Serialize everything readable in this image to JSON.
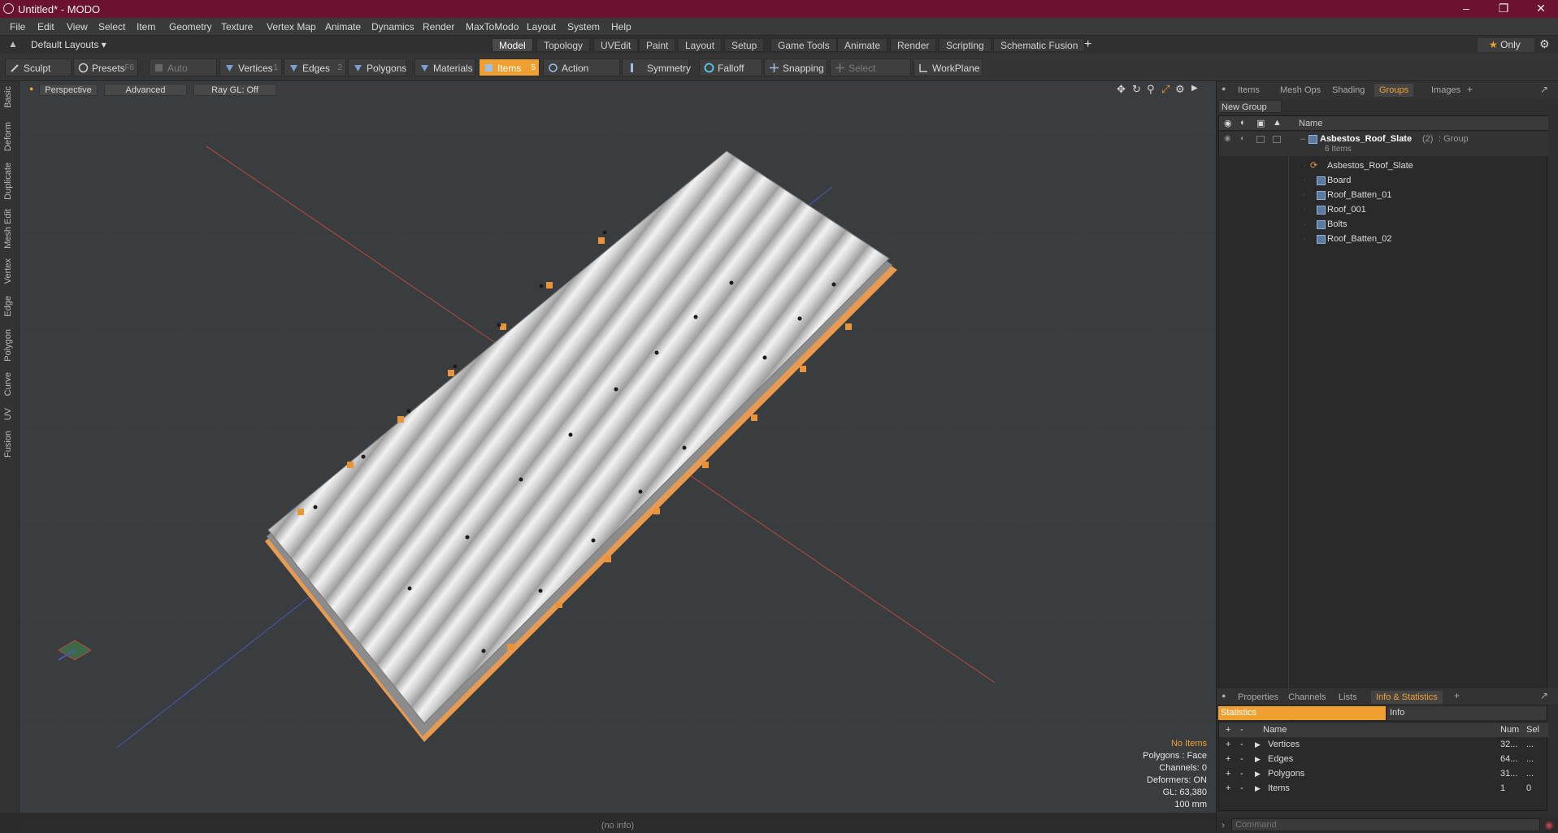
{
  "window": {
    "title": "Untitled* - MODO"
  },
  "menubar": [
    "File",
    "Edit",
    "View",
    "Select",
    "Item",
    "Geometry",
    "Texture",
    "Vertex Map",
    "Animate",
    "Dynamics",
    "Render",
    "MaxToModo",
    "Layout",
    "System",
    "Help"
  ],
  "layouts": {
    "current": "Default Layouts",
    "only_label": "Only"
  },
  "layout_tabs": [
    "Model",
    "Topology",
    "UVEdit",
    "Paint",
    "Layout",
    "Setup",
    "Game Tools",
    "Animate",
    "Render",
    "Scripting",
    "Schematic Fusion"
  ],
  "toolbar": {
    "sculpt": "Sculpt",
    "presets": "Presets",
    "presets_key": "F6",
    "auto_select": "Auto Select",
    "vertices": "Vertices",
    "vertices_key": "1",
    "edges": "Edges",
    "edges_key": "2",
    "polygons": "Polygons",
    "materials": "Materials",
    "items": "Items",
    "items_key": "5",
    "action_center": "Action Center",
    "symmetry": "Symmetry",
    "falloff": "Falloff",
    "snapping": "Snapping",
    "select_through": "Select Through",
    "workplane": "WorkPlane"
  },
  "left_tabs": [
    "Basic",
    "Deform",
    "Duplicate",
    "Mesh Edit",
    "Vertex",
    "Edge",
    "Polygon",
    "Curve",
    "UV",
    "Fusion"
  ],
  "viewport": {
    "view": "Perspective",
    "shading": "Advanced",
    "raygl": "Ray GL: Off",
    "stats": {
      "items": "No Items",
      "polygons": "Polygons : Face",
      "channels": "Channels: 0",
      "deformers": "Deformers: ON",
      "gl": "GL: 63,380",
      "scale": "100 mm"
    }
  },
  "status": "(no info)",
  "groups_panel": {
    "tabs": [
      "Items",
      "Mesh Ops",
      "Shading",
      "Groups",
      "Images"
    ],
    "new_group": "New Group",
    "column_name": "Name",
    "group_name": "Asbestos_Roof_Slate",
    "group_count": "(2)",
    "group_type": ": Group",
    "group_items": "6 Items",
    "children": [
      "Asbestos_Roof_Slate",
      "Board",
      "Roof_Batten_01",
      "Roof_001",
      "Bolts",
      "Roof_Batten_02"
    ]
  },
  "info_panel": {
    "tabs": [
      "Properties",
      "Channels",
      "Lists",
      "Info & Statistics"
    ],
    "sub_tabs": [
      "Statistics",
      "Info"
    ],
    "columns": [
      "Name",
      "Num",
      "Sel"
    ],
    "rows": [
      {
        "name": "Vertices",
        "num": "32...",
        "sel": "..."
      },
      {
        "name": "Edges",
        "num": "64...",
        "sel": "..."
      },
      {
        "name": "Polygons",
        "num": "31...",
        "sel": "..."
      },
      {
        "name": "Items",
        "num": "1",
        "sel": "0"
      }
    ]
  },
  "command": {
    "placeholder": "Command"
  },
  "colors": {
    "accent": "#f0a030",
    "titlebar": "#6b1231",
    "viewport_bg": "#393d40"
  }
}
